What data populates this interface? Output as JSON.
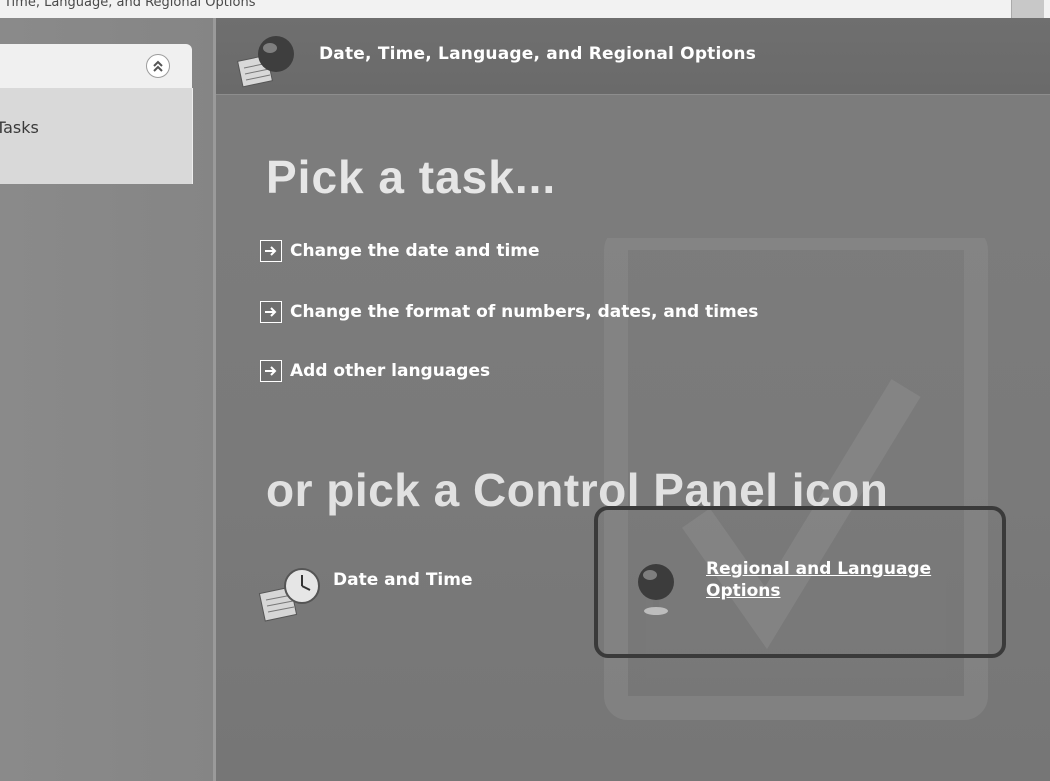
{
  "window": {
    "title": "Time, Language, and Regional Options"
  },
  "left_pane": {
    "task_item_label": "Tasks"
  },
  "banner": {
    "title": "Date, Time, Language, and Regional Options"
  },
  "main": {
    "pick_task_heading": "Pick a task...",
    "tasks": [
      {
        "label": "Change the date and time"
      },
      {
        "label": "Change the format of numbers, dates, and times"
      },
      {
        "label": "Add other languages"
      }
    ],
    "control_panel_heading": "or pick a Control Panel icon",
    "icons": [
      {
        "label": "Date and Time",
        "icon": "calendar-clock-icon"
      },
      {
        "label": "Regional and Language Options",
        "icon": "globe-icon"
      }
    ]
  }
}
